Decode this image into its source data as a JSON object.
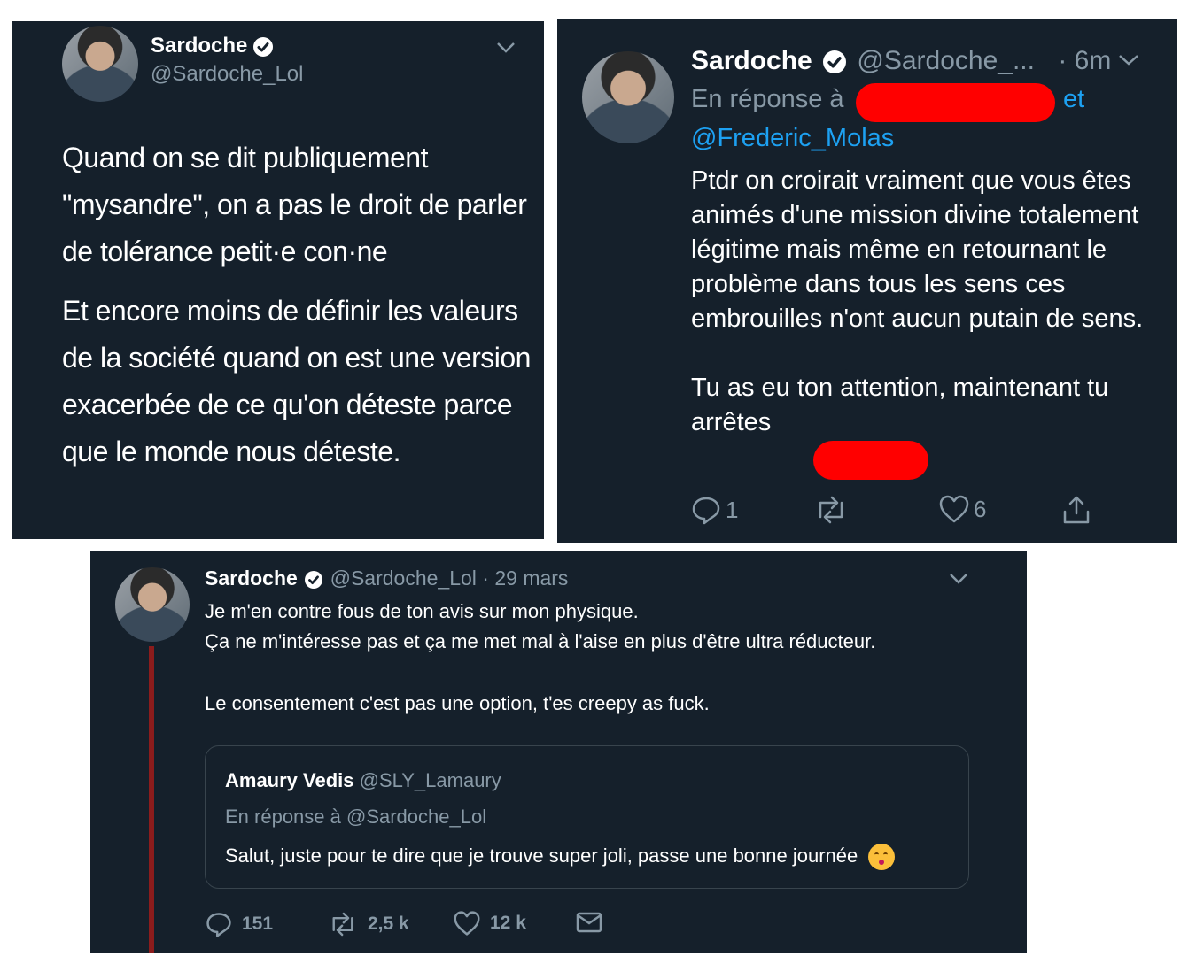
{
  "tweet1": {
    "name": "Sardoche",
    "handle": "@Sardoche_Lol",
    "paragraphs": [
      "Quand on se dit publiquement \"mysandre\", on a pas le droit de parler de tolérance petit·e con·ne",
      "Et encore moins de définir les valeurs de la société quand on est une version exacerbée de ce qu'on déteste parce que le monde nous déteste."
    ],
    "icons": [
      "verified-badge-icon",
      "chevron-down-icon"
    ]
  },
  "tweet2": {
    "name": "Sardoche",
    "handle": "@Sardoche_...",
    "time": "· 6m",
    "reply_prefix": "En réponse à",
    "reply_and": "et",
    "reply_mention": "@Frederic_Molas",
    "paragraphs": [
      "Ptdr on croirait vraiment que vous êtes animés d'une mission divine totalement légitime mais même en retournant le problème dans tous les sens ces embrouilles n'ont aucun putain de sens.",
      "Tu as eu ton attention, maintenant tu arrêtes"
    ],
    "actions": {
      "reply_count": "1",
      "retweet_count": "",
      "like_count": "6"
    },
    "redaction_color": "#ff0000"
  },
  "tweet3": {
    "name": "Sardoche",
    "handle": "@Sardoche_Lol",
    "date": "· 29 mars",
    "lines": [
      "Je m'en contre fous de ton avis sur mon physique.",
      "Ça ne m'intéresse pas et ça me met mal à l'aise en plus d'être ultra réducteur.",
      "Le consentement c'est pas une option, t'es creepy as fuck."
    ],
    "quoted": {
      "name": "Amaury Vedis",
      "handle": "@SLY_Lamaury",
      "reply_to": "En réponse à @Sardoche_Lol",
      "text": "Salut, juste pour te dire que je trouve super joli, passe une bonne journée",
      "emoji": "kissing-face-emoji"
    },
    "actions": {
      "reply_count": "151",
      "retweet_count": "2,5 k",
      "like_count": "12 k"
    },
    "thread_color": "#8b1c1c"
  },
  "colors": {
    "background": "#15202b",
    "muted_text": "#8899a6",
    "link": "#1da1f2"
  }
}
